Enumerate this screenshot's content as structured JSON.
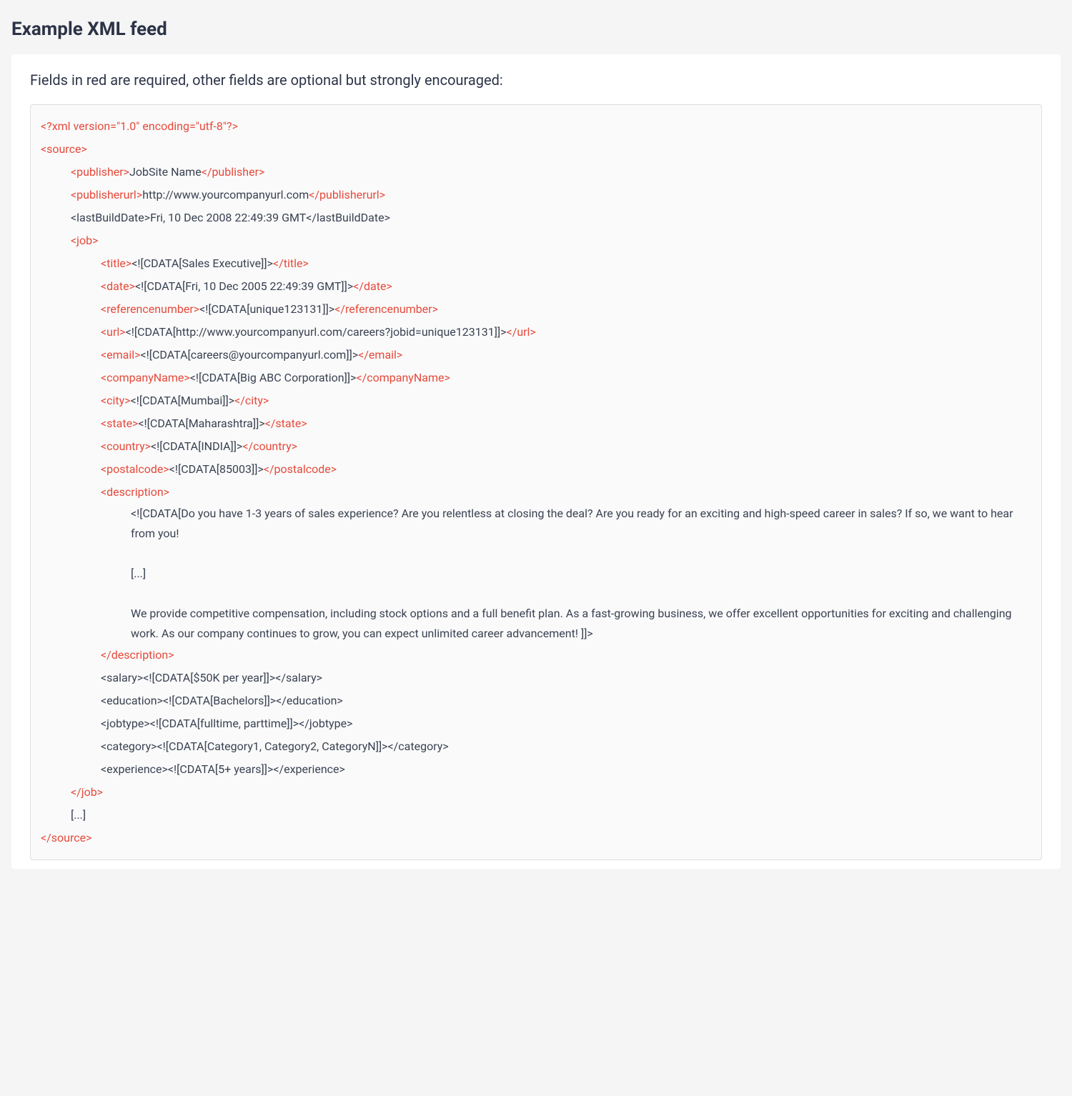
{
  "heading": "Example XML feed",
  "intro": "Fields in red are required, other fields are optional but strongly encouraged:",
  "xml": {
    "decl": "<?xml version=\"1.0\" encoding=\"utf-8\"?>",
    "source_open": "<source>",
    "source_close": "</source>",
    "publisher_open": "<publisher>",
    "publisher_val": "JobSite Name",
    "publisher_close": "</publisher>",
    "publisherurl_open": "<publisherurl>",
    "publisherurl_val": "http://www.yourcompanyurl.com",
    "publisherurl_close": "</publisherurl>",
    "lastBuildDate": "<lastBuildDate>Fri, 10 Dec 2008 22:49:39 GMT</lastBuildDate>",
    "job_open": "<job>",
    "job_close": "</job>",
    "title_open": "<title>",
    "title_val": "<![CDATA[Sales Executive]]>",
    "title_close": "</title>",
    "date_open": "<date>",
    "date_val": "<![CDATA[Fri, 10 Dec 2005 22:49:39 GMT]]>",
    "date_close": "</date>",
    "ref_open": "<referencenumber>",
    "ref_val": "<![CDATA[unique123131]]>",
    "ref_close": "</referencenumber>",
    "url_open": "<url>",
    "url_val": "<![CDATA[http://www.yourcompanyurl.com/careers?jobid=unique123131]]>",
    "url_close": "</url>",
    "email_open": "<email>",
    "email_val": "<![CDATA[careers@yourcompanyurl.com]]>",
    "email_close": "</email>",
    "company_open": "<companyName>",
    "company_val": "<![CDATA[Big ABC Corporation]]>",
    "company_close": "</companyName>",
    "city_open": "<city>",
    "city_val": "<![CDATA[Mumbai]]>",
    "city_close": "</city>",
    "state_open": "<state>",
    "state_val": "<![CDATA[Maharashtra]]>",
    "state_close": "</state>",
    "country_open": "<country>",
    "country_val": "<![CDATA[INDIA]]>",
    "country_close": "</country>",
    "postal_open": "<postalcode>",
    "postal_val": "<![CDATA[85003]]>",
    "postal_close": "</postalcode>",
    "description_open": "<description>",
    "description_close": "</description>",
    "desc_p1": "<![CDATA[Do you have 1-3 years of sales experience? Are you relentless at closing the deal? Are you ready for an exciting and high-speed career in sales? If so, we want to hear from you!",
    "desc_p2": "[...]",
    "desc_p3": "We provide competitive compensation, including stock options and a full benefit plan. As a fast-growing business, we offer excellent opportunities for exciting and challenging work. As our company continues to grow, you can expect unlimited career advancement! ]]>",
    "salary": "<salary><![CDATA[$50K per year]]></salary>",
    "education": "<education><![CDATA[Bachelors]]></education>",
    "jobtype": "<jobtype><![CDATA[fulltime, parttime]]></jobtype>",
    "category": "<category><![CDATA[Category1, Category2, CategoryN]]></category>",
    "experience": "<experience><![CDATA[5+ years]]></experience>",
    "ellipsis": "[...]"
  }
}
